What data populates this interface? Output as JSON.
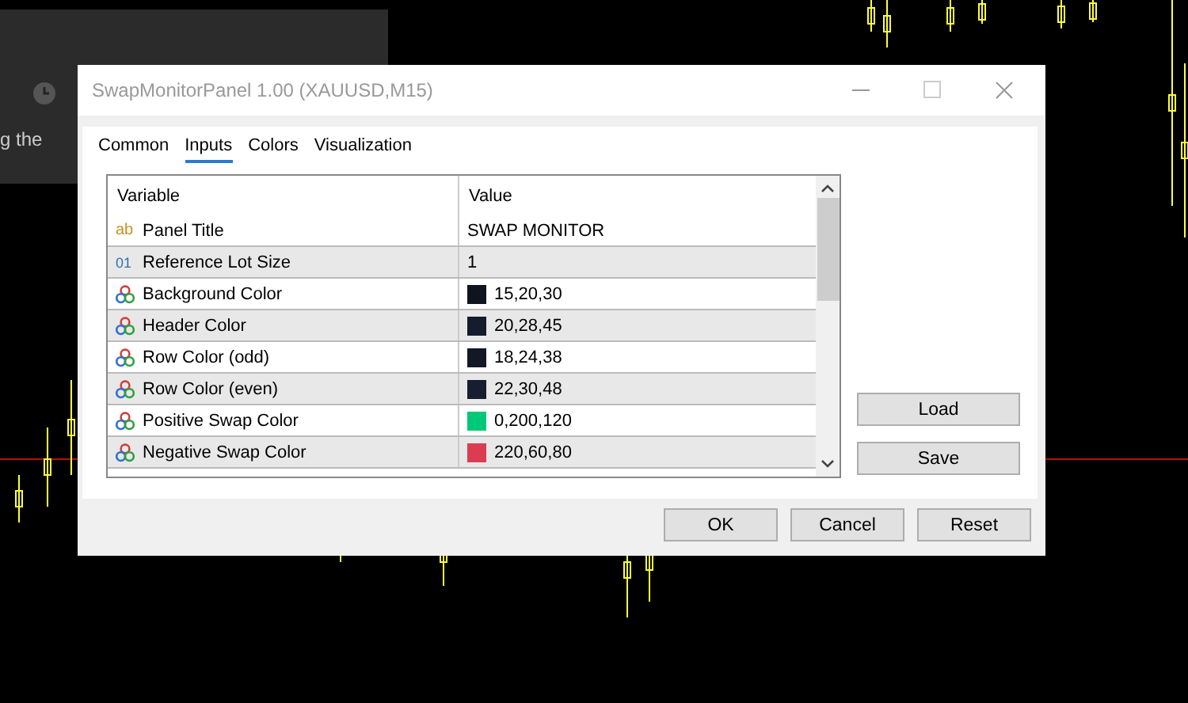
{
  "background_panel": {
    "text": "g the"
  },
  "window": {
    "title": "SwapMonitorPanel 1.00 (XAUUSD,M15)"
  },
  "tabs": [
    {
      "label": "Common",
      "selected": false
    },
    {
      "label": "Inputs",
      "selected": true
    },
    {
      "label": "Colors",
      "selected": false
    },
    {
      "label": "Visualization",
      "selected": false
    }
  ],
  "table": {
    "columns": [
      "Variable",
      "Value"
    ],
    "rows": [
      {
        "kind": "string",
        "icon": "ab",
        "variable": "Panel Title",
        "value": "SWAP MONITOR"
      },
      {
        "kind": "int",
        "icon": "01",
        "variable": "Reference Lot Size",
        "value": "1"
      },
      {
        "kind": "color",
        "variable": "Background Color",
        "value": "15,20,30",
        "color": "#0f141e"
      },
      {
        "kind": "color",
        "variable": "Header Color",
        "value": "20,28,45",
        "color": "#141c2d"
      },
      {
        "kind": "color",
        "variable": "Row Color (odd)",
        "value": "18,24,38",
        "color": "#121826"
      },
      {
        "kind": "color",
        "variable": "Row Color (even)",
        "value": "22,30,48",
        "color": "#161e30"
      },
      {
        "kind": "color",
        "variable": "Positive Swap Color",
        "value": "0,200,120",
        "color": "#00c878"
      },
      {
        "kind": "color",
        "variable": "Negative Swap Color",
        "value": "220,60,80",
        "color": "#dc3c50"
      }
    ]
  },
  "side_buttons": [
    "Load",
    "Save"
  ],
  "buttons": [
    "OK",
    "Cancel",
    "Reset"
  ]
}
